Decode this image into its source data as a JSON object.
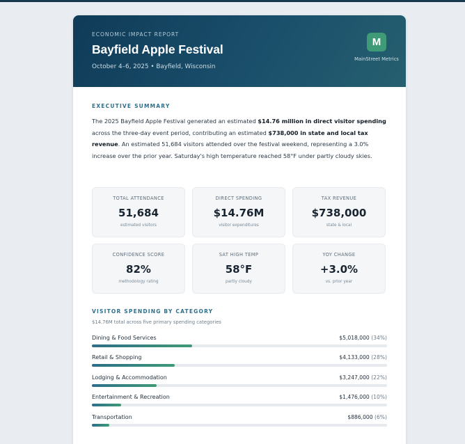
{
  "report": {
    "eyebrow": "ECONOMIC IMPACT REPORT",
    "title": "Bayfield Apple Festival",
    "subtitle": "October 4–6, 2025 • Bayfield, Wisconsin",
    "logo_letter": "M",
    "brand": "MainStreet Metrics"
  },
  "summary": {
    "heading": "EXECUTIVE SUMMARY",
    "t1": "The 2025 Bayfield Apple Festival generated an estimated ",
    "b1": "$14.76 million in direct visitor spending",
    "t2": " across the three-day event period, contributing an estimated ",
    "b2": "$738,000 in state and local tax revenue",
    "t3": ". An estimated 51,684 visitors attended over the festival weekend, representing a 3.0% increase over the prior year. Saturday's high temperature reached 58°F under partly cloudy skies."
  },
  "metrics": [
    {
      "label": "TOTAL ATTENDANCE",
      "value": "51,684",
      "sub": "estimated visitors"
    },
    {
      "label": "DIRECT SPENDING",
      "value": "$14.76M",
      "sub": "visitor expenditures"
    },
    {
      "label": "TAX REVENUE",
      "value": "$738,000",
      "sub": "state & local"
    },
    {
      "label": "CONFIDENCE SCORE",
      "value": "82%",
      "sub": "methodology rating"
    },
    {
      "label": "SAT HIGH TEMP",
      "value": "58°F",
      "sub": "partly cloudy"
    },
    {
      "label": "YOY CHANGE",
      "value": "+3.0%",
      "sub": "vs. prior year"
    }
  ],
  "spending": {
    "heading": "VISITOR SPENDING BY CATEGORY",
    "note": "$14.76M total across five primary spending categories",
    "rows": [
      {
        "label": "Dining & Food Services",
        "amount": "$5,018,000",
        "pct": "(34%)",
        "share": 34
      },
      {
        "label": "Retail & Shopping",
        "amount": "$4,133,000",
        "pct": "(28%)",
        "share": 28
      },
      {
        "label": "Lodging & Accommodation",
        "amount": "$3,247,000",
        "pct": "(22%)",
        "share": 22
      },
      {
        "label": "Entertainment & Recreation",
        "amount": "$1,476,000",
        "pct": "(10%)",
        "share": 10
      },
      {
        "label": "Transportation",
        "amount": "$886,000",
        "pct": "(6%)",
        "share": 6
      }
    ]
  },
  "colors": {
    "header": "#0f3b58",
    "accent": "#3f9a77",
    "bar_start": "#2d6e8a"
  }
}
